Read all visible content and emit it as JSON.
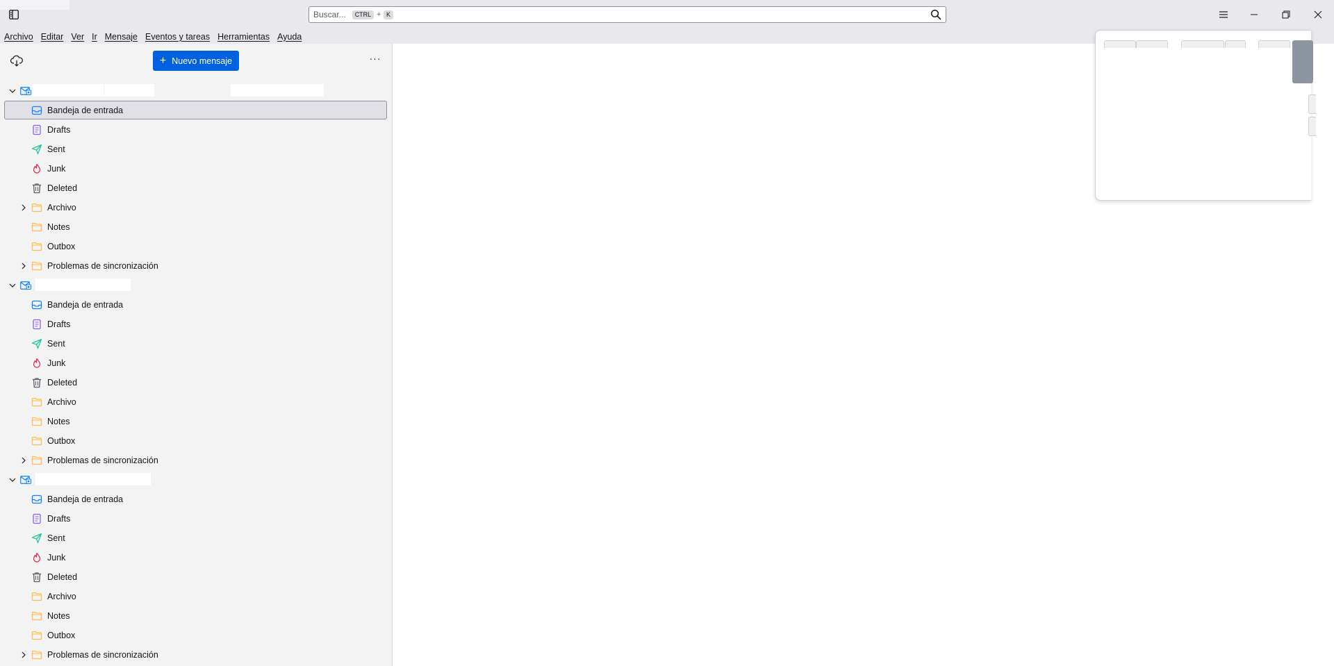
{
  "titlebar": {
    "search": {
      "placeholder": "Buscar...",
      "key1": "CTRL",
      "plus": "+",
      "key2": "K"
    }
  },
  "menubar": {
    "items": [
      "Archivo",
      "Editar",
      "Ver",
      "Ir",
      "Mensaje",
      "Eventos y tareas",
      "Herramientas",
      "Ayuda"
    ]
  },
  "folder_pane": {
    "new_message_label": "Nuevo mensaje",
    "more_label": "···",
    "accounts": [
      {
        "folders": [
          {
            "label": "Bandeja de entrada",
            "icon": "inbox-icon",
            "selected": true
          },
          {
            "label": "Drafts",
            "icon": "drafts-icon"
          },
          {
            "label": "Sent",
            "icon": "sent-icon"
          },
          {
            "label": "Junk",
            "icon": "junk-icon"
          },
          {
            "label": "Deleted",
            "icon": "trash-icon"
          },
          {
            "label": "Archivo",
            "icon": "folder-icon",
            "expandable": true
          },
          {
            "label": "Notes",
            "icon": "folder-icon"
          },
          {
            "label": "Outbox",
            "icon": "folder-icon"
          },
          {
            "label": "Problemas de sincronización",
            "icon": "folder-icon",
            "expandable": true
          }
        ]
      },
      {
        "folders": [
          {
            "label": "Bandeja de entrada",
            "icon": "inbox-icon"
          },
          {
            "label": "Drafts",
            "icon": "drafts-icon"
          },
          {
            "label": "Sent",
            "icon": "sent-icon"
          },
          {
            "label": "Junk",
            "icon": "junk-icon"
          },
          {
            "label": "Deleted",
            "icon": "trash-icon"
          },
          {
            "label": "Archivo",
            "icon": "folder-icon"
          },
          {
            "label": "Notes",
            "icon": "folder-icon"
          },
          {
            "label": "Outbox",
            "icon": "folder-icon"
          },
          {
            "label": "Problemas de sincronización",
            "icon": "folder-icon",
            "expandable": true
          }
        ]
      },
      {
        "folders": [
          {
            "label": "Bandeja de entrada",
            "icon": "inbox-icon"
          },
          {
            "label": "Drafts",
            "icon": "drafts-icon"
          },
          {
            "label": "Sent",
            "icon": "sent-icon"
          },
          {
            "label": "Junk",
            "icon": "junk-icon"
          },
          {
            "label": "Deleted",
            "icon": "trash-icon"
          },
          {
            "label": "Archivo",
            "icon": "folder-icon"
          },
          {
            "label": "Notes",
            "icon": "folder-icon"
          },
          {
            "label": "Outbox",
            "icon": "folder-icon"
          },
          {
            "label": "Problemas de sincronización",
            "icon": "folder-icon",
            "expandable": true
          }
        ]
      }
    ]
  },
  "colors": {
    "accent": "#0061e0",
    "inbox": "#0a84ff",
    "drafts": "#9059ff",
    "sent": "#2ac3a2",
    "junk": "#e22850",
    "trash": "#5b5b66",
    "folder": "#ffbd4f"
  }
}
